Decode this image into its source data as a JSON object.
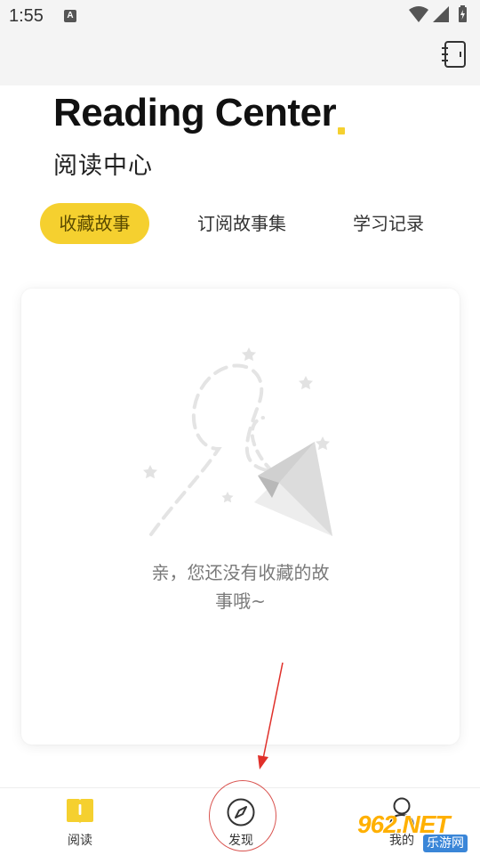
{
  "status_bar": {
    "time": "1:55",
    "notification_icon": "a-icon",
    "indicators": [
      "wifi-icon",
      "signal-icon",
      "battery-charging-icon"
    ]
  },
  "toolbar": {
    "notebook_icon": "notebook-icon"
  },
  "header": {
    "title": "Reading Center",
    "subtitle": "阅读中心",
    "accent_color": "#f5d02f"
  },
  "tabs": [
    {
      "label": "收藏故事",
      "active": true
    },
    {
      "label": "订阅故事集",
      "active": false
    },
    {
      "label": "学习记录",
      "active": false
    }
  ],
  "empty_state": {
    "illustration": "paper-plane-illustration",
    "line1": "亲，您还没有收藏的故",
    "line2": "事哦~"
  },
  "bottom_nav": {
    "items": [
      {
        "label": "阅读",
        "icon": "book-icon"
      },
      {
        "label": "发现",
        "icon": "compass-icon"
      },
      {
        "label": "我的",
        "icon": "user-icon"
      }
    ]
  },
  "annotation": {
    "arrow_color": "#e0302a"
  },
  "watermark": {
    "logo": "962.NET",
    "site": "乐游网"
  }
}
